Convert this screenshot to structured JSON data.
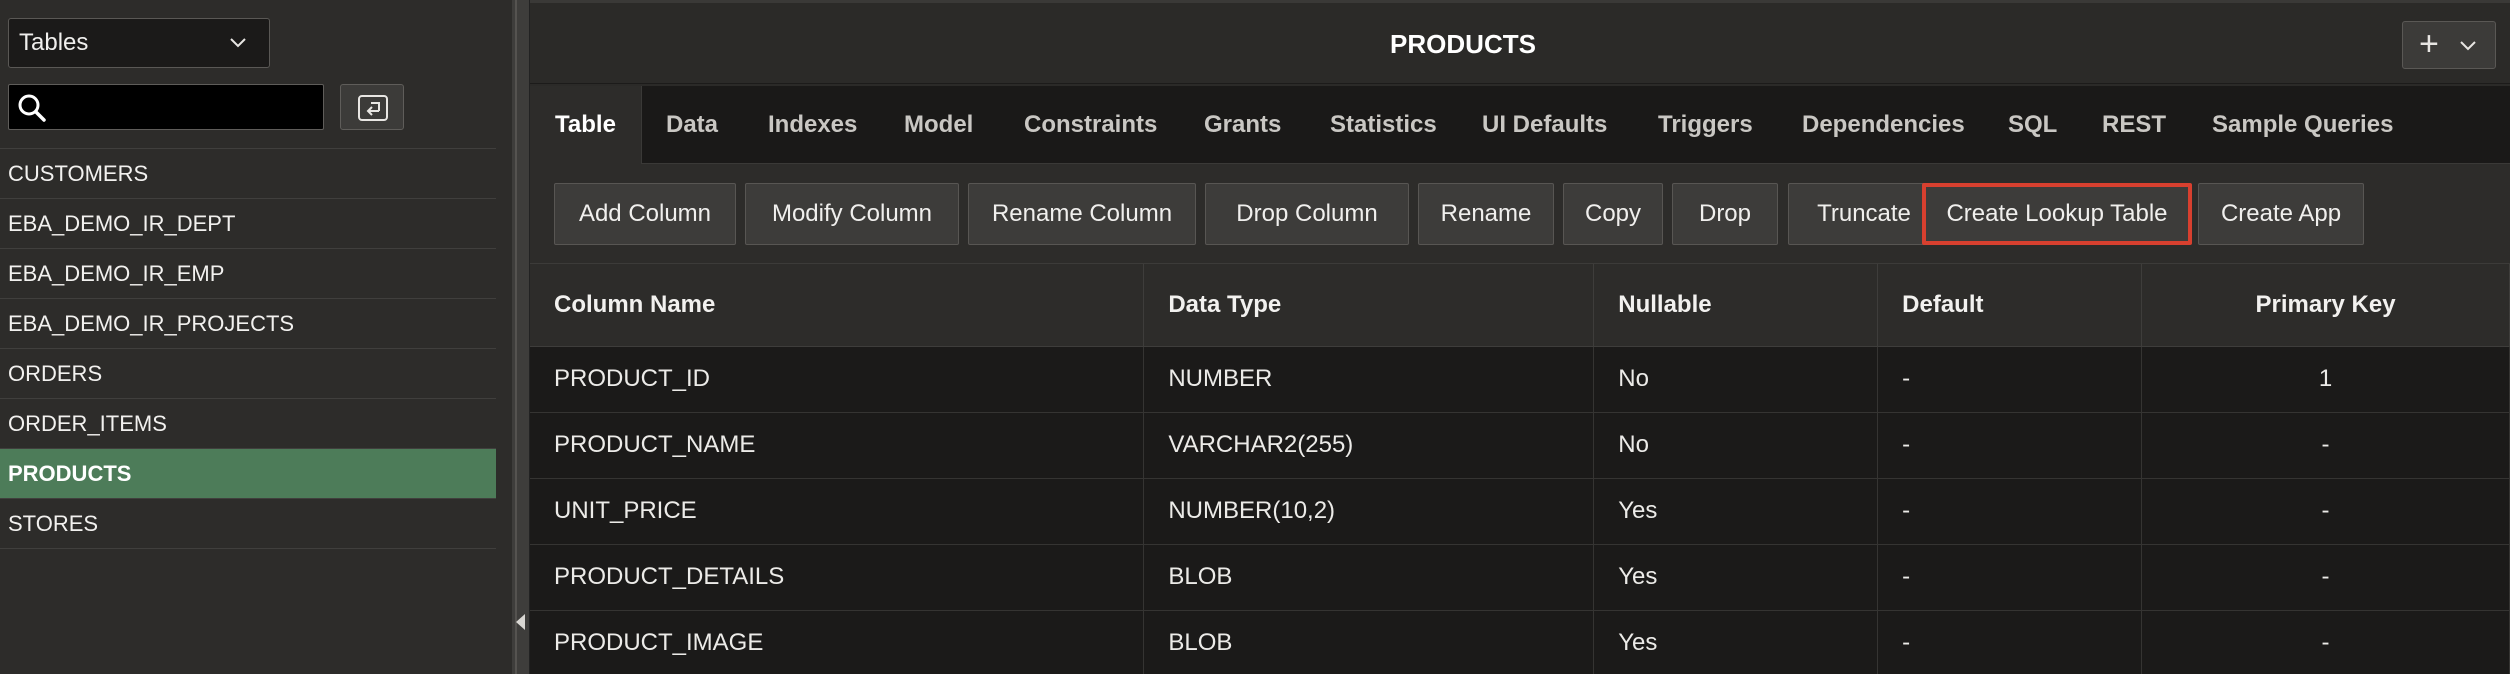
{
  "sidebar": {
    "object_type": "Tables",
    "search": {
      "value": "",
      "placeholder": ""
    },
    "tables": [
      {
        "name": "CUSTOMERS"
      },
      {
        "name": "EBA_DEMO_IR_DEPT"
      },
      {
        "name": "EBA_DEMO_IR_EMP"
      },
      {
        "name": "EBA_DEMO_IR_PROJECTS"
      },
      {
        "name": "ORDERS"
      },
      {
        "name": "ORDER_ITEMS"
      },
      {
        "name": "PRODUCTS",
        "selected": true
      },
      {
        "name": "STORES"
      }
    ]
  },
  "header": {
    "title": "PRODUCTS",
    "add_button": "+"
  },
  "tabs": [
    {
      "label": "Table",
      "active": true
    },
    {
      "label": "Data"
    },
    {
      "label": "Indexes"
    },
    {
      "label": "Model"
    },
    {
      "label": "Constraints"
    },
    {
      "label": "Grants"
    },
    {
      "label": "Statistics"
    },
    {
      "label": "UI Defaults"
    },
    {
      "label": "Triggers"
    },
    {
      "label": "Dependencies"
    },
    {
      "label": "SQL"
    },
    {
      "label": "REST"
    },
    {
      "label": "Sample Queries"
    }
  ],
  "toolbar": {
    "buttons": [
      {
        "label": "Add Column"
      },
      {
        "label": "Modify Column"
      },
      {
        "label": "Rename Column"
      },
      {
        "label": "Drop Column"
      },
      {
        "label": "Rename"
      },
      {
        "label": "Copy"
      },
      {
        "label": "Drop"
      },
      {
        "label": "Truncate"
      },
      {
        "label": "Create Lookup Table",
        "highlighted": true
      },
      {
        "label": "Create App"
      }
    ]
  },
  "columns_table": {
    "headers": [
      "Column Name",
      "Data Type",
      "Nullable",
      "Default",
      "Primary Key"
    ],
    "rows": [
      [
        "PRODUCT_ID",
        "NUMBER",
        "No",
        "-",
        "1"
      ],
      [
        "PRODUCT_NAME",
        "VARCHAR2(255)",
        "No",
        "-",
        "-"
      ],
      [
        "UNIT_PRICE",
        "NUMBER(10,2)",
        "Yes",
        "-",
        "-"
      ],
      [
        "PRODUCT_DETAILS",
        "BLOB",
        "Yes",
        "-",
        "-"
      ],
      [
        "PRODUCT_IMAGE",
        "BLOB",
        "Yes",
        "-",
        "-"
      ]
    ]
  },
  "colors": {
    "selected_row": "#4d7c59",
    "highlight_border": "#d8402f"
  },
  "icons": [
    "chevron-down-icon",
    "search-icon",
    "back-arrow-icon",
    "plus-icon",
    "collapse-left-icon"
  ]
}
